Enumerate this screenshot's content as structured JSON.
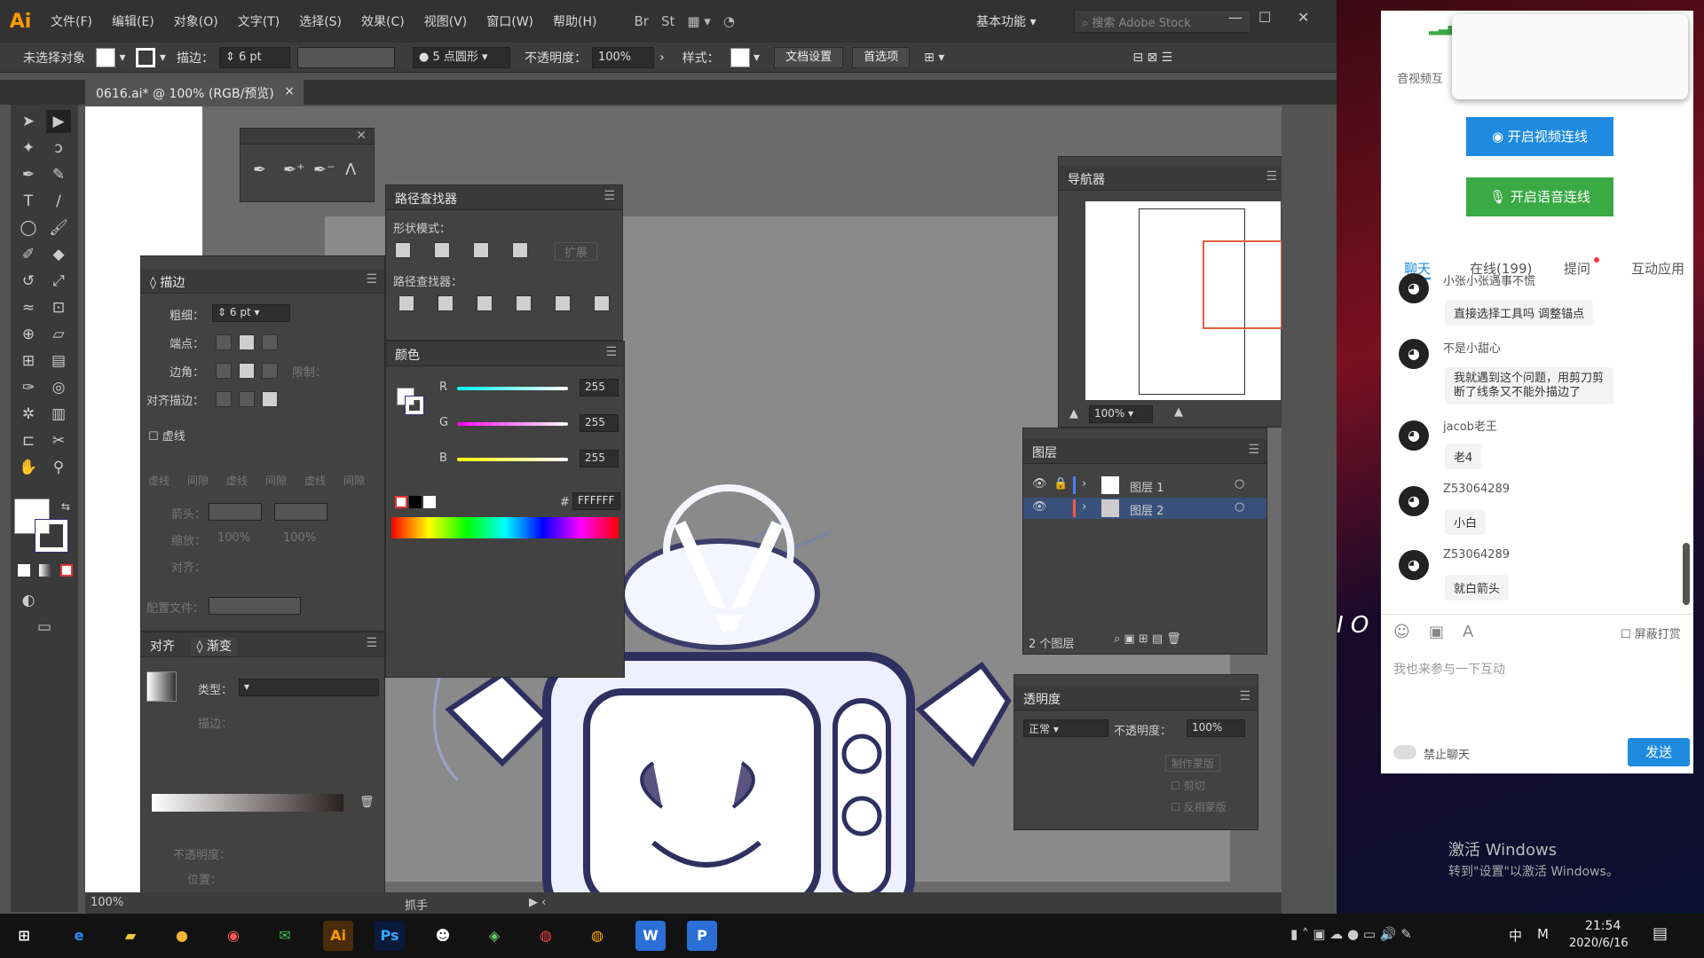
{
  "app": {
    "logo": "Ai",
    "menu": [
      "文件(F)",
      "编辑(E)",
      "对象(O)",
      "文字(T)",
      "选择(S)",
      "效果(C)",
      "视图(V)",
      "窗口(W)",
      "帮助(H)"
    ],
    "toolbar_icons": [
      "Br",
      "St"
    ],
    "workspace": "基本功能",
    "search_placeholder": "搜索 Adobe Stock"
  },
  "control_bar": {
    "selection": "未选择对象",
    "stroke_label": "描边：",
    "stroke_value": "6 pt",
    "brush": "5 点圆形",
    "opacity_label": "不透明度：",
    "opacity_value": "100%",
    "style_label": "样式：",
    "doc_settings": "文档设置",
    "preferences": "首选项"
  },
  "document_tab": {
    "title": "0616.ai* @ 100% (RGB/预览)",
    "close": "×"
  },
  "pathfinder": {
    "title": "路径查找器",
    "shape_modes": "形状模式：",
    "expand": "扩展",
    "pathfinders": "路径查找器："
  },
  "stroke_panel": {
    "title": "描边",
    "weight_label": "粗细：",
    "weight_value": "6 pt",
    "cap_label": "端点：",
    "corner_label": "边角：",
    "limit_label": "限制：",
    "align_label": "对齐描边：",
    "dashed_label": "虚线",
    "dash_labels": [
      "虚线",
      "间隙",
      "虚线",
      "间隙",
      "虚线",
      "间隙"
    ],
    "arrow_label": "箭头：",
    "scale_label": "缩放：",
    "scale_values": [
      "100%",
      "100%"
    ],
    "align2_label": "对齐：",
    "profile_label": "配置文件："
  },
  "color_panel": {
    "title": "颜色",
    "channels": [
      {
        "name": "R",
        "value": "255"
      },
      {
        "name": "G",
        "value": "255"
      },
      {
        "name": "B",
        "value": "255"
      }
    ],
    "hex_label": "#",
    "hex": "FFFFFF"
  },
  "gradient_panel": {
    "tab_align": "对齐",
    "tab_gradient": "渐变",
    "type_label": "类型：",
    "stroke_label": "描边：",
    "opacity_label": "不透明度：",
    "position_label": "位置："
  },
  "navigator": {
    "title": "导航器",
    "zoom": "100%"
  },
  "layers": {
    "title": "图层",
    "items": [
      {
        "name": "图层 1",
        "color": "#4a7fff"
      },
      {
        "name": "图层 2",
        "color": "#ff5a3c"
      }
    ],
    "count": "2 个图层"
  },
  "transparency": {
    "title": "透明度",
    "mode": "正常",
    "opacity_label": "不透明度：",
    "opacity_value": "100%",
    "make_mask": "制作蒙版",
    "clip": "剪切",
    "invert": "反相蒙版"
  },
  "status": {
    "zoom": "100%",
    "tool": "抓手"
  },
  "chat": {
    "audio_label": "音视频互",
    "video_btn": "开启视频连线",
    "voice_btn": "开启语音连线",
    "tabs": [
      "聊天",
      "在线(199)",
      "提问",
      "互动应用"
    ],
    "messages": [
      {
        "name": "小张小张遇事不慌",
        "text": "直接选择工具吗 调整锚点"
      },
      {
        "name": "不是小甜心",
        "text": "我就遇到这个问题，用剪刀剪断了线条又不能外描边了"
      },
      {
        "name": "jacob老王",
        "text": "老4"
      },
      {
        "name": "Z53064289",
        "text": "小白"
      },
      {
        "name": "Z53064289",
        "text": "就白箭头"
      }
    ],
    "block_tips": "屏蔽打赏",
    "input_placeholder": "我也来参与一下互动",
    "mute_label": "禁止聊天",
    "send": "发送"
  },
  "desktop": {
    "watermark_title": "激活 Windows",
    "watermark_sub": "转到\"设置\"以激活 Windows。"
  },
  "taskbar": {
    "time": "21:54",
    "date": "2020/6/16",
    "ime": "中",
    "ime2": "M"
  }
}
